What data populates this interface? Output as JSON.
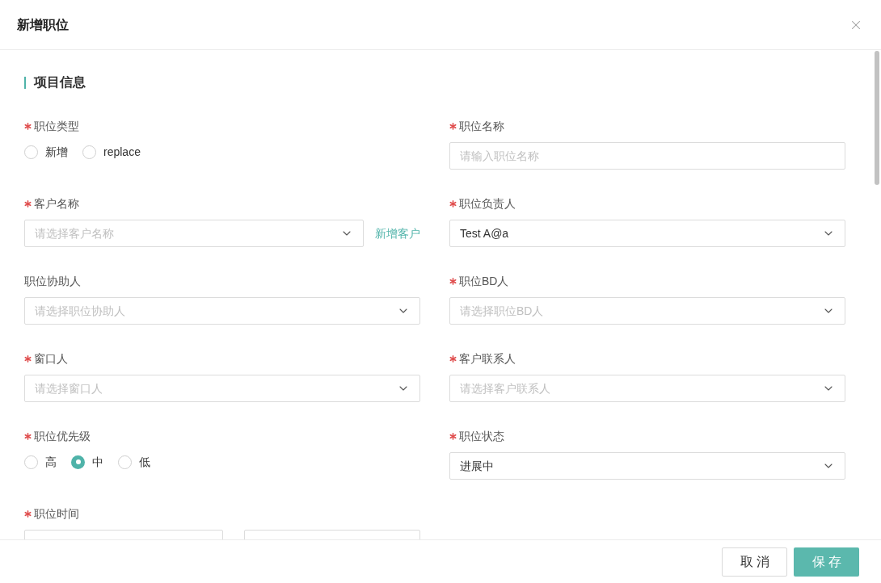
{
  "dialog": {
    "title": "新增职位"
  },
  "section": {
    "title": "项目信息"
  },
  "fields": [
    {
      "kind": "radio",
      "label": "职位类型",
      "required": true,
      "options": [
        {
          "label": "新增",
          "selected": false
        },
        {
          "label": "replace",
          "selected": false
        }
      ]
    },
    {
      "kind": "input",
      "label": "职位名称",
      "required": true,
      "placeholder": "请输入职位名称"
    },
    {
      "kind": "select",
      "label": "客户名称",
      "required": true,
      "placeholder": "请选择客户名称",
      "link": "新增客户"
    },
    {
      "kind": "select",
      "label": "职位负责人",
      "required": true,
      "value": "Test A@a"
    },
    {
      "kind": "select",
      "label": "职位协助人",
      "required": false,
      "placeholder": "请选择职位协助人"
    },
    {
      "kind": "select",
      "label": "职位BD人",
      "required": true,
      "placeholder": "请选择职位BD人"
    },
    {
      "kind": "select",
      "label": "窗口人",
      "required": true,
      "placeholder": "请选择窗口人"
    },
    {
      "kind": "select",
      "label": "客户联系人",
      "required": true,
      "placeholder": "请选择客户联系人"
    },
    {
      "kind": "radio",
      "label": "职位优先级",
      "required": true,
      "options": [
        {
          "label": "高",
          "selected": false
        },
        {
          "label": "中",
          "selected": true
        },
        {
          "label": "低",
          "selected": false
        }
      ]
    },
    {
      "kind": "select",
      "label": "职位状态",
      "required": true,
      "value": "进展中"
    },
    {
      "kind": "date_range",
      "label": "职位时间",
      "required": true
    }
  ],
  "footer": {
    "buttons": [
      {
        "label": "取消",
        "kind": "secondary"
      },
      {
        "label": "保存",
        "kind": "primary"
      }
    ]
  }
}
